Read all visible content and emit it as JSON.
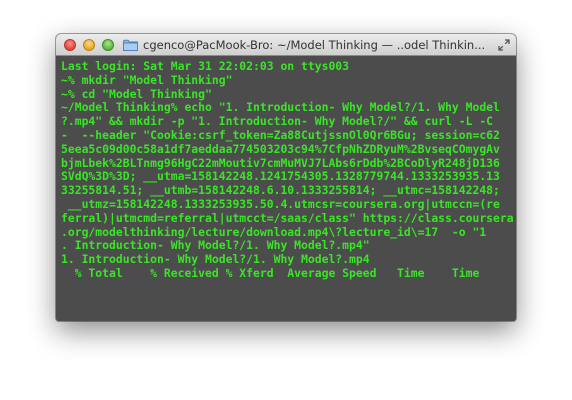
{
  "window": {
    "title": "cgenco@PacMook-Bro: ~/Model Thinking — ..odel Thinkin..."
  },
  "colors": {
    "terminal_bg": "#4c4c4c",
    "terminal_text": "#39e626"
  },
  "icons": {
    "folder": "folder-icon",
    "fullscreen": "fullscreen-icon"
  },
  "terminal": {
    "lines": [
      "Last login: Sat Mar 31 22:02:03 on ttys003",
      "~% mkdir \"Model Thinking\"",
      "~% cd \"Model Thinking\"",
      "~/Model Thinking% echo \"1. Introduction- Why Model?/1. Why Model",
      "?.mp4\" && mkdir -p \"1. Introduction- Why Model?/\" && curl -L -C",
      "-  --header \"Cookie:csrf_token=Za88CutjssnOl0Qr6BGu; session=c62",
      "5eea5c09d00c58a1df7aeddaa774503203c94%7CfpNhZDRyuM%2BvseqCOmygAv",
      "bjmLbek%2BLTnmg96HgC22mMoutiv7cmMuMVJ7LAbs6rDdb%2BCoDlyR248jD136",
      "SVdQ%3D%3D; __utma=158142248.1241754305.1328779744.1333253935.13",
      "33255814.51; __utmb=158142248.6.10.1333255814; __utmc=158142248;",
      " __utmz=158142248.1333253935.50.4.utmcsr=coursera.org|utmccn=(re",
      "ferral)|utmcmd=referral|utmcct=/saas/class\" https://class.coursera",
      ".org/modelthinking/lecture/download.mp4\\?lecture_id\\=17  -o \"1",
      ". Introduction- Why Model?/1. Why Model?.mp4\"",
      "1. Introduction- Why Model?/1. Why Model?.mp4"
    ],
    "progress_header": "  % Total    % Received % Xferd  Average Speed   Time    Time"
  }
}
